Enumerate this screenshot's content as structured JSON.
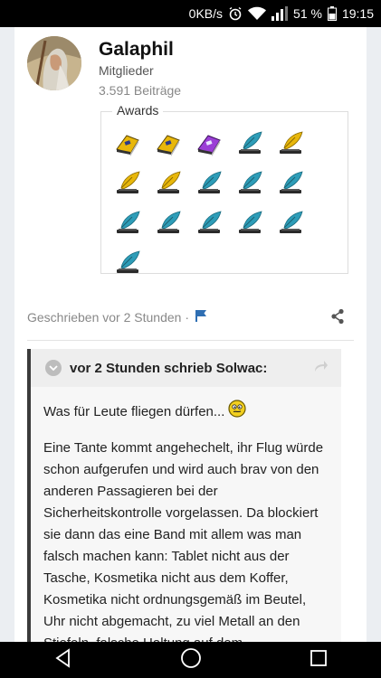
{
  "status_bar": {
    "speed": "0KB/s",
    "battery": "51 %",
    "time": "19:15"
  },
  "post": {
    "author": {
      "name": "Galaphil",
      "group": "Mitglieder",
      "posts": "3.591 Beiträge"
    },
    "awards_label": "Awards",
    "awards": [
      {
        "icon": "yellow-book-icon"
      },
      {
        "icon": "yellow-book-icon"
      },
      {
        "icon": "purple-book-icon"
      },
      {
        "icon": "blue-quill-icon"
      },
      {
        "icon": "gold-quill-icon"
      },
      {
        "icon": "gold-quill-icon"
      },
      {
        "icon": "gold-quill-icon"
      },
      {
        "icon": "blue-quill-icon"
      },
      {
        "icon": "blue-quill-icon"
      },
      {
        "icon": "blue-quill-icon"
      },
      {
        "icon": "blue-quill-icon"
      },
      {
        "icon": "blue-quill-icon"
      },
      {
        "icon": "blue-quill-icon"
      },
      {
        "icon": "blue-quill-icon"
      },
      {
        "icon": "blue-quill-icon"
      },
      {
        "icon": "blue-quill-icon"
      }
    ],
    "meta": "Geschrieben vor 2 Stunden ·",
    "quote": {
      "header": "vor 2 Stunden schrieb Solwac:",
      "line1": "Was für Leute fliegen dürfen...",
      "paragraph": "Eine Tante kommt angehechelt, ihr Flug würde schon aufgerufen und wird auch brav von den anderen Passagieren bei der Sicherheitskontrolle vorgelassen. Da blockiert sie dann das eine Band mit allem was man falsch machen kann: Tablet nicht aus der Tasche, Kosmetika nicht aus dem Koffer, Kosmetika nicht ordnungsgemäß im Beutel, Uhr nicht abgemacht, zu viel Metall an den Stiefeln, falsche Haltung auf dem"
    }
  },
  "colors": {
    "gold": "#e8b70b",
    "blue_feather": "#2e9db8",
    "flag": "#2f6fb3",
    "quote_border": "#3b3b3b"
  }
}
